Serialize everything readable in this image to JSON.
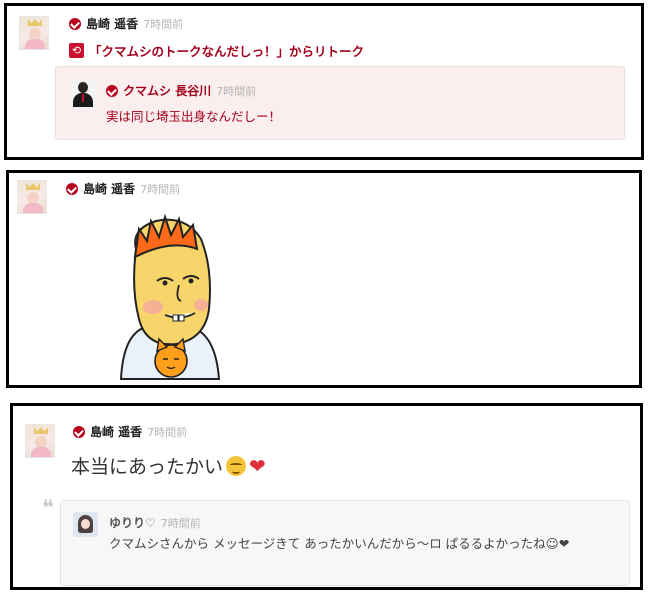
{
  "post1": {
    "user": {
      "name": "島崎 遥香",
      "time": "7時間前"
    },
    "retalk": {
      "icon": "retalk-icon",
      "text": "「クマムシのトークなんだしっ！」からリトーク"
    },
    "quote": {
      "user": {
        "name": "クマムシ 長谷川",
        "time": "7時間前"
      },
      "text": "実は同じ埼玉出身なんだしー！"
    }
  },
  "post2": {
    "user": {
      "name": "島崎 遥香",
      "time": "7時間前"
    },
    "image": "sticker-illustration"
  },
  "post3": {
    "user": {
      "name": "島崎 遥香",
      "time": "7時間前"
    },
    "text": "本当にあったかい",
    "emoji": [
      "relieved-face-emoji",
      "red-heart-emoji"
    ],
    "quote_mark": "❝",
    "reply": {
      "user": {
        "name": "ゆりり♡",
        "time": "7時間前"
      },
      "text": "クマムシさんから メッセージきて あったかいんだから〜ロ ぱるるよかったね☺❤"
    }
  },
  "colors": {
    "accent": "#b8001c",
    "quote_bg": "#fbeeee",
    "reply_bg": "#f7f7f7",
    "time_gray": "#b5b5b5"
  }
}
